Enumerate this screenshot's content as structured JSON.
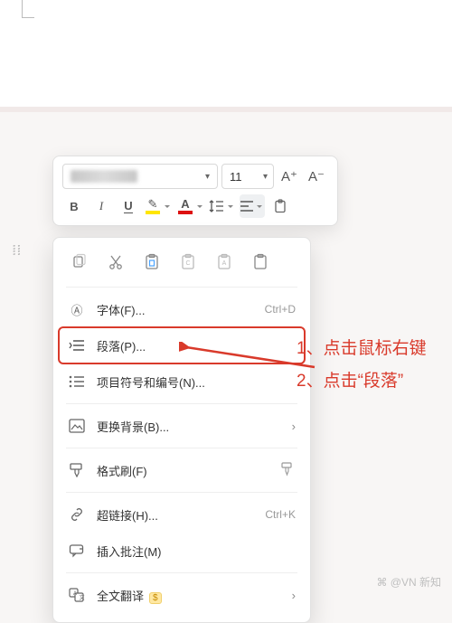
{
  "toolbar": {
    "font_size": "11",
    "inc_label": "A⁺",
    "dec_label": "A⁻",
    "bold": "B",
    "italic": "I",
    "underline": "U"
  },
  "context_menu": {
    "items": [
      {
        "label": "字体(F)...",
        "shortcut": "Ctrl+D"
      },
      {
        "label": "段落(P)..."
      },
      {
        "label": "项目符号和编号(N)..."
      },
      {
        "label": "更换背景(B)..."
      },
      {
        "label": "格式刷(F)"
      },
      {
        "label": "超链接(H)...",
        "shortcut": "Ctrl+K"
      },
      {
        "label": "插入批注(M)"
      },
      {
        "label": "全文翻译"
      }
    ],
    "translate_badge": "$"
  },
  "annotations": {
    "line1": "1、点击鼠标右键",
    "line2": "2、点击“段落”"
  },
  "watermark": "⌘ @VN 新知"
}
